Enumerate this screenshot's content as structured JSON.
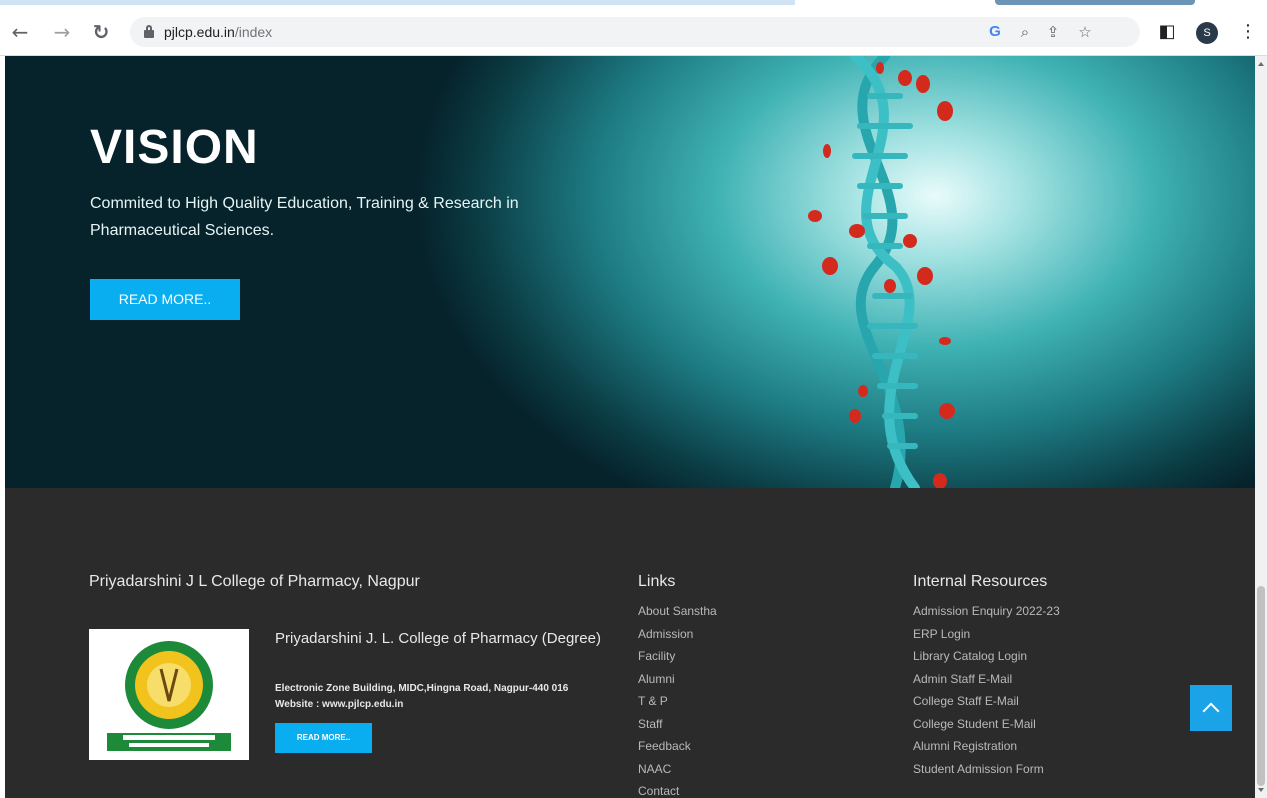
{
  "browser": {
    "url_host": "pjlcp.edu.in",
    "url_path": "/index",
    "profile_initial": "S",
    "icons": [
      "back-arrow-icon",
      "forward-arrow-icon",
      "reload-icon",
      "lock-icon",
      "google-icon",
      "zoom-icon",
      "share-icon",
      "star-icon",
      "side-panel-icon",
      "menu-dots-icon"
    ]
  },
  "hero": {
    "title": "VISION",
    "text": "Commited to High Quality Education, Training & Research in Pharmaceutical Sciences.",
    "button": "READ MORE.."
  },
  "footer": {
    "college_heading": "Priyadarshini J L College of Pharmacy, Nagpur",
    "college_name": "Priyadarshini J. L. College of Pharmacy (Degree)",
    "address": "Electronic Zone Building, MIDC,Hingna Road, Nagpur-440 016 Website : www.pjlcp.edu.in",
    "button": "READ MORE..",
    "links_heading": "Links",
    "links": [
      "About Sanstha",
      "Admission",
      "Facility",
      "Alumni",
      "T & P",
      "Staff",
      "Feedback",
      "NAAC",
      "Contact"
    ],
    "resources_heading": "Internal Resources",
    "resources": [
      "Admission Enquiry 2022-23",
      "ERP Login",
      "Library Catalog Login",
      "Admin Staff E-Mail",
      "College Staff E-Mail",
      "College Student E-Mail",
      "Alumni Registration",
      "Student Admission Form"
    ]
  },
  "colors": {
    "accent": "#08aef0",
    "footer_bg": "#2b2b2b",
    "scroll_top": "#1ba3e8"
  }
}
